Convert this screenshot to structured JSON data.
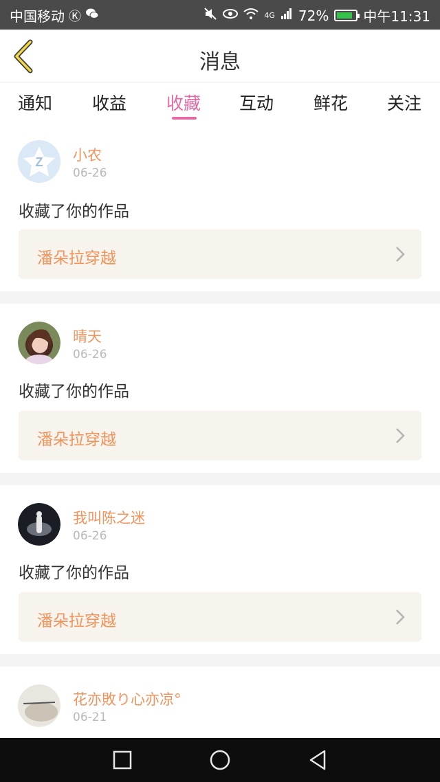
{
  "status_bar": {
    "carrier": "中国移动",
    "network": "4G",
    "battery": "72%",
    "time": "中午11:31"
  },
  "header": {
    "title": "消息"
  },
  "tabs": [
    {
      "label": "通知"
    },
    {
      "label": "收益"
    },
    {
      "label": "收藏",
      "active": true
    },
    {
      "label": "互动"
    },
    {
      "label": "鲜花"
    },
    {
      "label": "关注"
    }
  ],
  "items": [
    {
      "name": "小农",
      "date": "06-26",
      "action": "收藏了你的作品",
      "work": "潘朵拉穿越"
    },
    {
      "name": "晴天",
      "date": "06-26",
      "action": "收藏了你的作品",
      "work": "潘朵拉穿越"
    },
    {
      "name": "我叫陈之迷",
      "date": "06-26",
      "action": "收藏了你的作品",
      "work": "潘朵拉穿越"
    },
    {
      "name": "花亦敗り心亦凉°",
      "date": "06-21"
    }
  ],
  "colors": {
    "accent": "#e36aa2",
    "name_orange": "#f0935d",
    "card_bg": "#f6f4ec"
  }
}
